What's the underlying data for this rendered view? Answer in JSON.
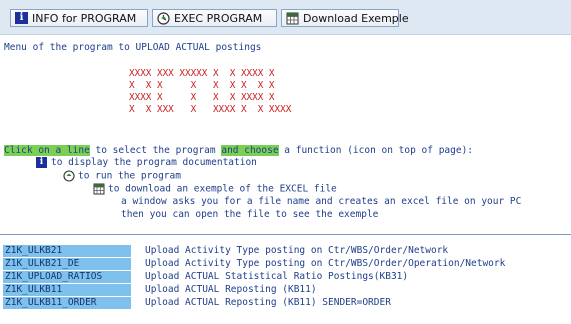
{
  "toolbar": {
    "buttons": [
      {
        "label": "INFO for PROGRAM",
        "icon": "info-icon"
      },
      {
        "label": "EXEC PROGRAM",
        "icon": "execute-icon"
      },
      {
        "label": "Download Exemple",
        "icon": "excel-icon"
      }
    ]
  },
  "intro": "Menu of the program to UPLOAD ACTUAL postings",
  "banner": [
    "XXXX XXX XXXXX X  X XXXX X",
    "X  X X     X   X  X X  X X",
    "XXXX X     X   X  X XXXX X",
    "X  X XXX   X   XXXX X  X XXXX"
  ],
  "help": {
    "hl1": "Click on a line",
    "mid1": " to select the program ",
    "hl2": "and choose",
    "rest": " a function (icon on top of page):",
    "info_line": "to display the program documentation",
    "exec_line": "to run the program",
    "download_line": "to download an exemple of the EXCEL file",
    "window_line": "a window asks you for a file name and creates an excel file on your PC",
    "open_line": "then you can open the file to see the exemple"
  },
  "programs": [
    {
      "code": "Z1K_ULKB21",
      "desc": "Upload Activity Type posting on Ctr/WBS/Order/Network"
    },
    {
      "code": "Z1K_ULKB21_DE",
      "desc": "Upload Activity Type posting on Ctr/WBS/Order/Operation/Network"
    },
    {
      "code": "Z1K_UPLOAD_RATIOS",
      "desc": "Upload ACTUAL Statistical Ratio Postings(KB31)"
    },
    {
      "code": "Z1K_ULKB11",
      "desc": "Upload ACTUAL Reposting (KB11)"
    },
    {
      "code": "Z1K_ULKB11_ORDER",
      "desc": "Upload ACTUAL Reposting (KB11) SENDER=ORDER"
    }
  ],
  "colors": {
    "highlight": "#7ccf55",
    "code_bg": "#7ec1ec",
    "banner": "#cc1f1f",
    "text": "#1f3f8a"
  }
}
